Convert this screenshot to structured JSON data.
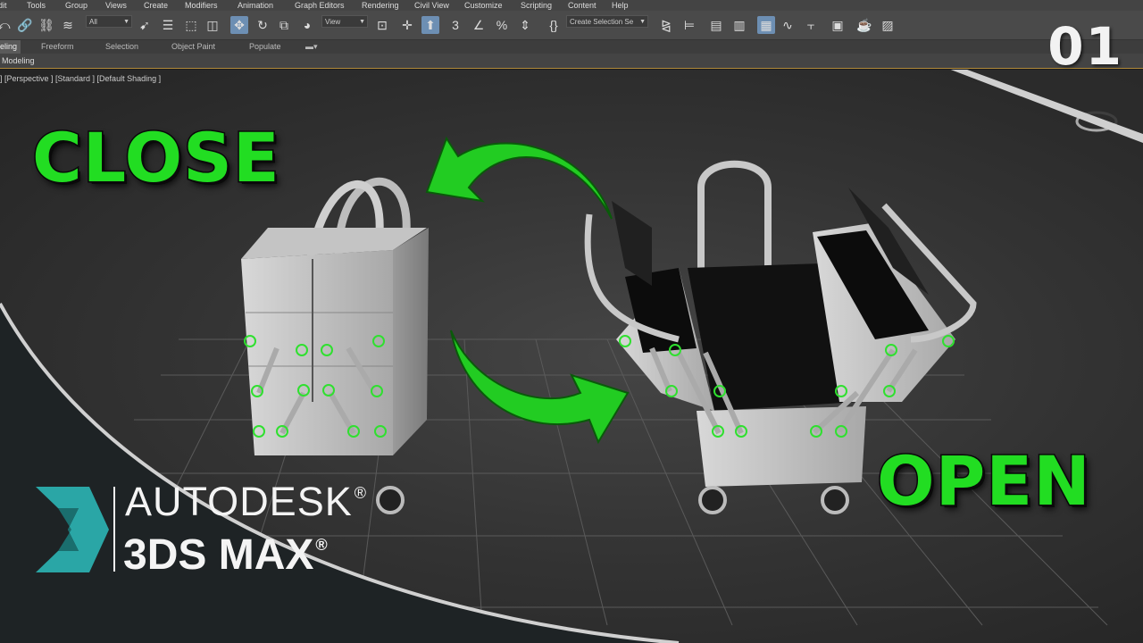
{
  "menu": [
    "dit",
    "Tools",
    "Group",
    "Views",
    "Create",
    "Modifiers",
    "Animation",
    "Graph Editors",
    "Rendering",
    "Civil View",
    "Customize",
    "Scripting",
    "Content",
    "Help"
  ],
  "toolbar": {
    "filter_value": "All",
    "coord_value": "View",
    "selection_set_value": "Create Selection Se",
    "icons": [
      "undo-icon",
      "link-icon",
      "unlink-icon",
      "bind-space-warp-icon",
      "select-object-icon",
      "select-by-name-icon",
      "rect-selection-icon",
      "window-crossing-icon",
      "move-icon",
      "rotate-icon",
      "scale-icon",
      "place-icon",
      "pivot-icon",
      "snap-3d-icon",
      "angle-snap-icon",
      "percent-snap-icon",
      "spinner-snap-icon",
      "edit-named-sets-icon",
      "mirror-icon",
      "align-icon",
      "layer-manager-icon",
      "ribbon-toggle-icon",
      "curve-editor-icon",
      "schematic-view-icon",
      "material-editor-icon",
      "render-setup-icon",
      "render-frame-icon",
      "render-icon"
    ]
  },
  "ribbon": {
    "tabs": [
      "eling",
      "Freeform",
      "Selection",
      "Object Paint",
      "Populate"
    ],
    "active_tab": "eling",
    "panel_label": "Modeling"
  },
  "viewport": {
    "label": "] [Perspective ] [Standard ] [Default Shading ]"
  },
  "thumbnail": {
    "close_label": "CLOSE",
    "open_label": "OPEN",
    "episode_number": "01",
    "brand_line1": "AUTODESK",
    "brand_line2": "3DS MAX",
    "registered_mark": "®",
    "accent_color": "#22dd22",
    "brand_logo_color": "#2aa6a6"
  }
}
